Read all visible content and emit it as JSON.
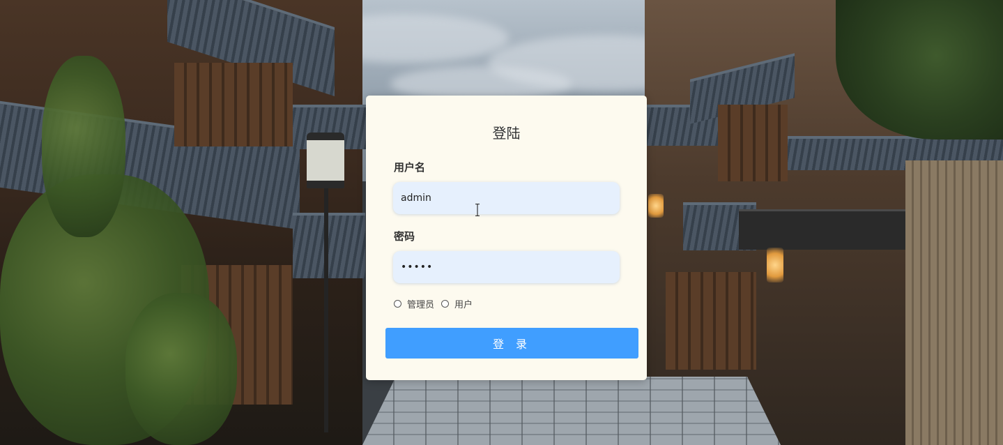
{
  "login": {
    "title": "登陆",
    "username_label": "用户名",
    "username_value": "admin",
    "password_label": "密码",
    "password_value": "•••••",
    "roles": [
      {
        "label": "管理员",
        "selected": false
      },
      {
        "label": "用户",
        "selected": false
      }
    ],
    "submit_label": "登 录"
  },
  "colors": {
    "card_background": "#fdfaef",
    "input_background": "#e6f0fd",
    "button_primary": "#409eff"
  },
  "icons": {
    "cursor": "i-beam-cursor-icon"
  }
}
